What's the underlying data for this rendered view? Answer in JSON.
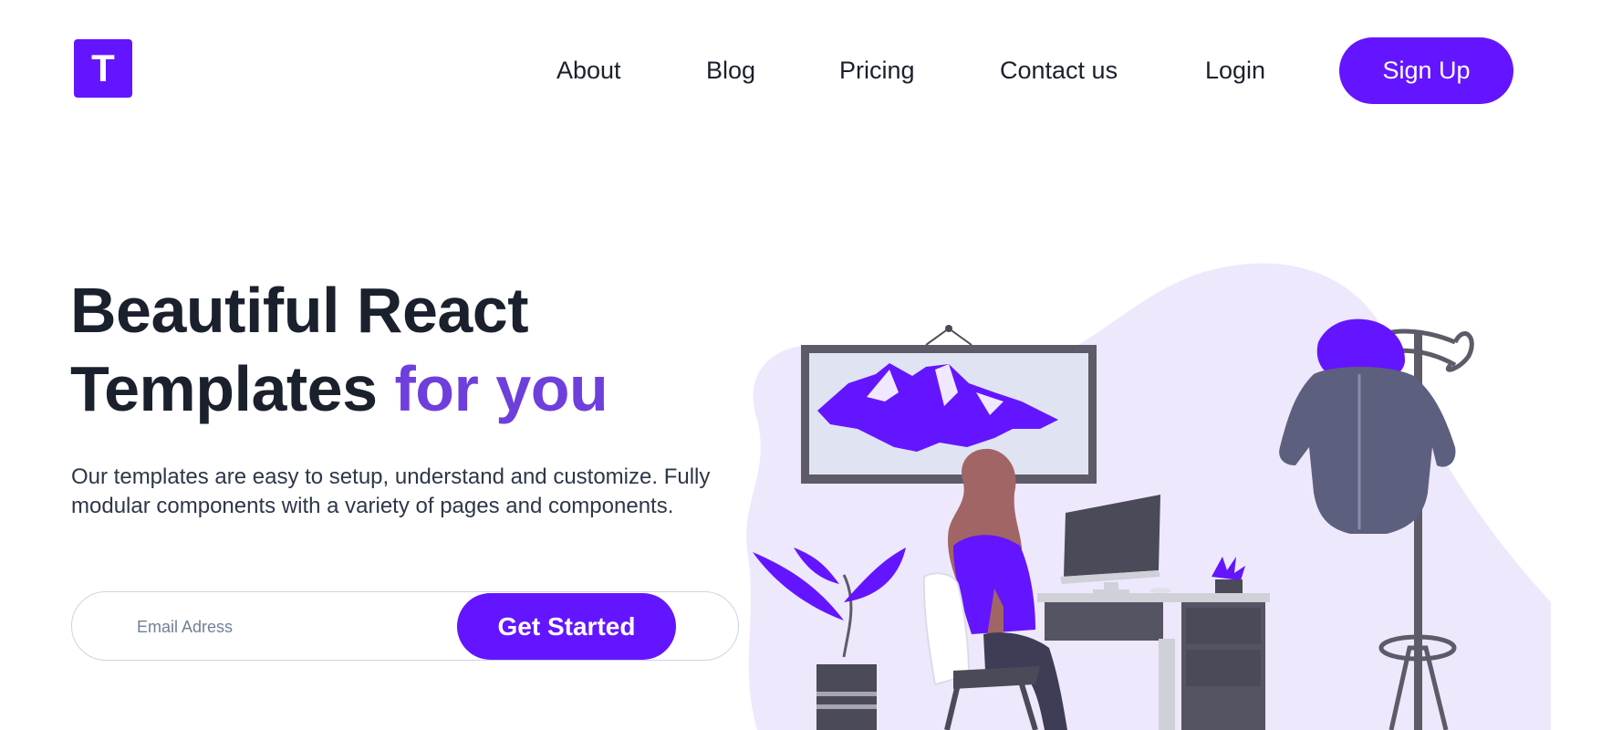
{
  "brand": {
    "logo_letter": "T",
    "accent_color": "#6415ff"
  },
  "nav": {
    "items": [
      {
        "label": "About"
      },
      {
        "label": "Blog"
      },
      {
        "label": "Pricing"
      },
      {
        "label": "Contact us"
      },
      {
        "label": "Login"
      }
    ],
    "signup_label": "Sign Up"
  },
  "hero": {
    "title_line1": "Beautiful React",
    "title_line2": "Templates ",
    "title_accent": "for you",
    "description_line1": "Our templates are easy to setup, understand and customize.",
    "description_line2": "Fully modular components with a variety of pages and components.",
    "email_placeholder": "Email Adress",
    "cta_label": "Get Started"
  },
  "illustration": {
    "name": "woman-at-desk-illustration"
  }
}
